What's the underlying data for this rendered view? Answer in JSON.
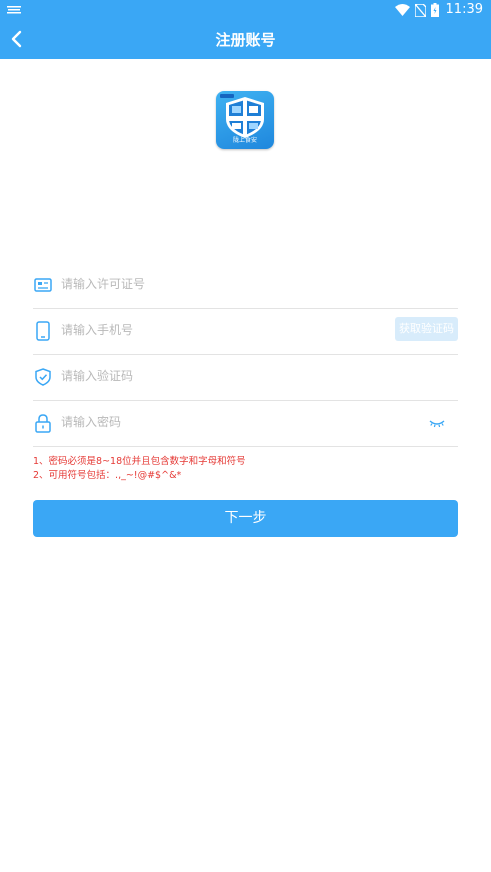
{
  "status_bar": {
    "time": "11:39"
  },
  "header": {
    "title": "注册账号"
  },
  "logo": {
    "text": "陇上食安"
  },
  "form": {
    "license_placeholder": "请输入许可证号",
    "phone_placeholder": "请输入手机号",
    "get_code_label": "获取验证码",
    "code_placeholder": "请输入验证码",
    "password_placeholder": "请输入密码"
  },
  "notes": {
    "line1": "1、密码必须是8~18位并且包含数字和字母和符号",
    "line2": "2、可用符号包括：.,_~!@#$^&*"
  },
  "actions": {
    "next_label": "下一步"
  },
  "colors": {
    "primary": "#3aa7f5",
    "note_red": "#e53935",
    "code_btn_bg": "#d8ecfb"
  }
}
